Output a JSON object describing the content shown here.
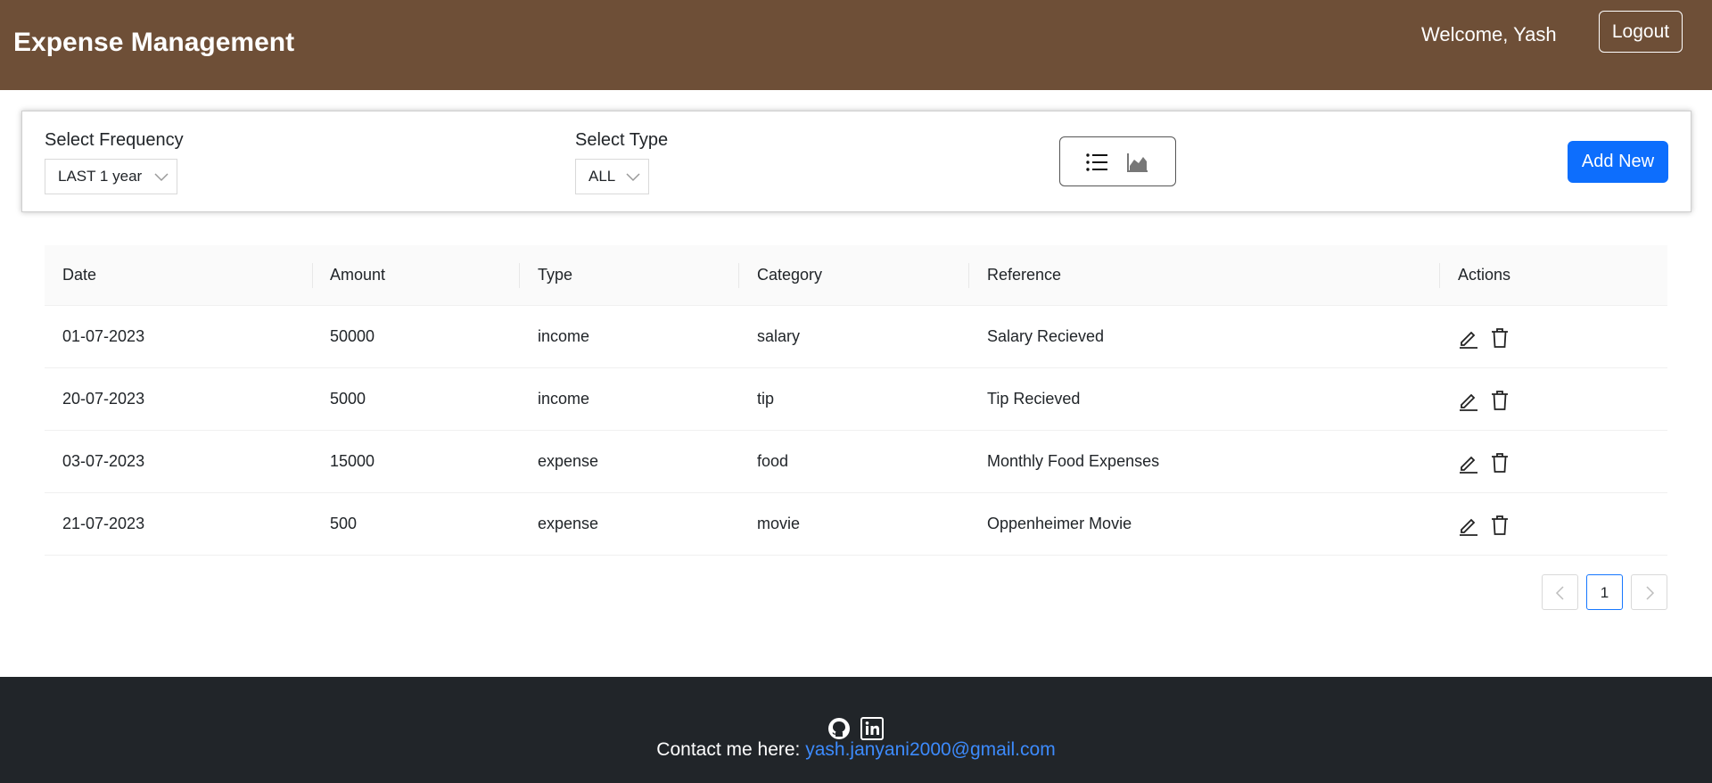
{
  "header": {
    "brand": "Expense Management",
    "welcome": "Welcome, Yash",
    "logout_label": "Logout"
  },
  "filters": {
    "frequency_label": "Select Frequency",
    "frequency_value": "LAST 1 year",
    "type_label": "Select Type",
    "type_value": "ALL",
    "view_icons": [
      "list-icon",
      "area-chart-icon"
    ],
    "add_new_label": "Add New"
  },
  "table": {
    "columns": [
      "Date",
      "Amount",
      "Type",
      "Category",
      "Reference",
      "Actions"
    ],
    "rows": [
      {
        "date": "01-07-2023",
        "amount": "50000",
        "type": "income",
        "category": "salary",
        "reference": "Salary Recieved"
      },
      {
        "date": "20-07-2023",
        "amount": "5000",
        "type": "income",
        "category": "tip",
        "reference": "Tip Recieved"
      },
      {
        "date": "03-07-2023",
        "amount": "15000",
        "type": "expense",
        "category": "food",
        "reference": "Monthly Food Expenses"
      },
      {
        "date": "21-07-2023",
        "amount": "500",
        "type": "expense",
        "category": "movie",
        "reference": "Oppenheimer Movie"
      }
    ],
    "row_action_icons": [
      "edit-icon",
      "delete-icon"
    ]
  },
  "pagination": {
    "current_page": "1"
  },
  "footer": {
    "icons": [
      "github-icon",
      "linkedin-icon"
    ],
    "contact_prefix": "Contact me here: ",
    "email": "yash.janyani2000@gmail.com"
  },
  "colors": {
    "header_bg": "#6e4f37",
    "primary": "#0d6efd",
    "footer_bg": "#212529",
    "link": "#3d8bfd"
  }
}
